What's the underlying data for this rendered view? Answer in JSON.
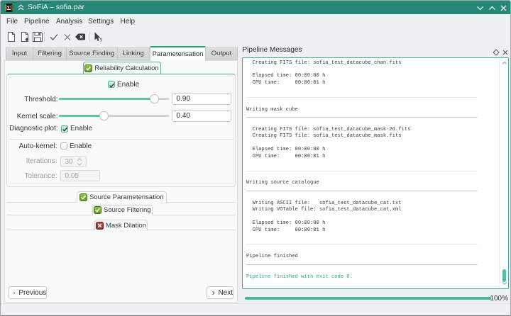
{
  "titlebar": {
    "title": "SoFiA – sofia.par"
  },
  "menubar": {
    "items": [
      "File",
      "Pipeline",
      "Analysis",
      "Settings",
      "Help"
    ]
  },
  "toolbar": {
    "buttons": [
      "new-file",
      "open-file",
      "save-file",
      "run-pipeline",
      "abort-pipeline",
      "clear-messages",
      "whats-this"
    ]
  },
  "tabs": {
    "items": [
      {
        "label": "Input",
        "active": false
      },
      {
        "label": "Filtering",
        "active": false
      },
      {
        "label": "Source Finding",
        "active": false
      },
      {
        "label": "Linking",
        "active": false
      },
      {
        "label": "Parameterisation",
        "active": true
      },
      {
        "label": "Output",
        "active": false
      }
    ]
  },
  "panel": {
    "section_label": "Reliability Calculation",
    "enable": {
      "label": "Enable",
      "checked": true
    },
    "threshold": {
      "label": "Threshold:",
      "value": "0.90",
      "fraction": 0.9
    },
    "kernel": {
      "label": "Kernel scale:",
      "value": "0.40",
      "fraction": 0.4
    },
    "diagnostic": {
      "label": "Diagnostic plot:",
      "checkbox_label": "Enable",
      "checked": true
    },
    "autokernel": {
      "label": "Auto-kernel:",
      "checkbox_label": "Enable",
      "checked": false
    },
    "iterations": {
      "label": "Iterations:",
      "value": "30",
      "disabled": true
    },
    "tolerance": {
      "label": "Tolerance:",
      "value": "0.05",
      "disabled": true
    },
    "sections": [
      {
        "label": "Source Parameterisation",
        "state": "checked"
      },
      {
        "label": "Source Filtering",
        "state": "checked"
      },
      {
        "label": "Mask Dilation",
        "state": "crossed"
      }
    ],
    "previous_label": "Previous",
    "next_label": "Next"
  },
  "dock": {
    "title": "Pipeline Messages",
    "log": [
      {
        "type": "text",
        "text": "  Creating FITS file: sofia_test_datacube_chan.fits"
      },
      {
        "type": "blank"
      },
      {
        "type": "text",
        "text": "  Elapsed time: 00:00:00 h"
      },
      {
        "type": "text",
        "text": "  CPU time:     00:00:01 h"
      },
      {
        "type": "blank"
      },
      {
        "type": "sep",
        "tone": "light"
      },
      {
        "type": "blank"
      },
      {
        "type": "text",
        "text": "Writing mask cube"
      },
      {
        "type": "sep",
        "tone": "dark"
      },
      {
        "type": "blank"
      },
      {
        "type": "text",
        "text": "  Creating FITS file: sofia_test_datacube_mask-2d.fits"
      },
      {
        "type": "text",
        "text": "  Creating FITS file: sofia_test_datacube_mask.fits"
      },
      {
        "type": "blank"
      },
      {
        "type": "text",
        "text": "  Elapsed time: 00:00:00 h"
      },
      {
        "type": "text",
        "text": "  CPU time:     00:00:01 h"
      },
      {
        "type": "blank"
      },
      {
        "type": "sep",
        "tone": "light"
      },
      {
        "type": "blank"
      },
      {
        "type": "text",
        "text": "Writing source catalogue"
      },
      {
        "type": "sep",
        "tone": "dark"
      },
      {
        "type": "blank"
      },
      {
        "type": "text",
        "text": "  Writing ASCII file:   sofia_test_datacube_cat.txt"
      },
      {
        "type": "text",
        "text": "  Writing VOTable file: sofia_test_datacube_cat.xml"
      },
      {
        "type": "blank"
      },
      {
        "type": "text",
        "text": "  Elapsed time: 00:00:00 h"
      },
      {
        "type": "text",
        "text": "  CPU time:     00:00:01 h"
      },
      {
        "type": "blank"
      },
      {
        "type": "sep",
        "tone": "light"
      },
      {
        "type": "blank"
      },
      {
        "type": "text",
        "text": "Pipeline finished"
      },
      {
        "type": "sep",
        "tone": "dark"
      },
      {
        "type": "blank"
      },
      {
        "type": "text",
        "text": "Pipeline finished with exit code 0.",
        "tone": "success"
      }
    ],
    "separator_char_count": 76
  },
  "statusbar": {
    "progress_label": "100%"
  }
}
